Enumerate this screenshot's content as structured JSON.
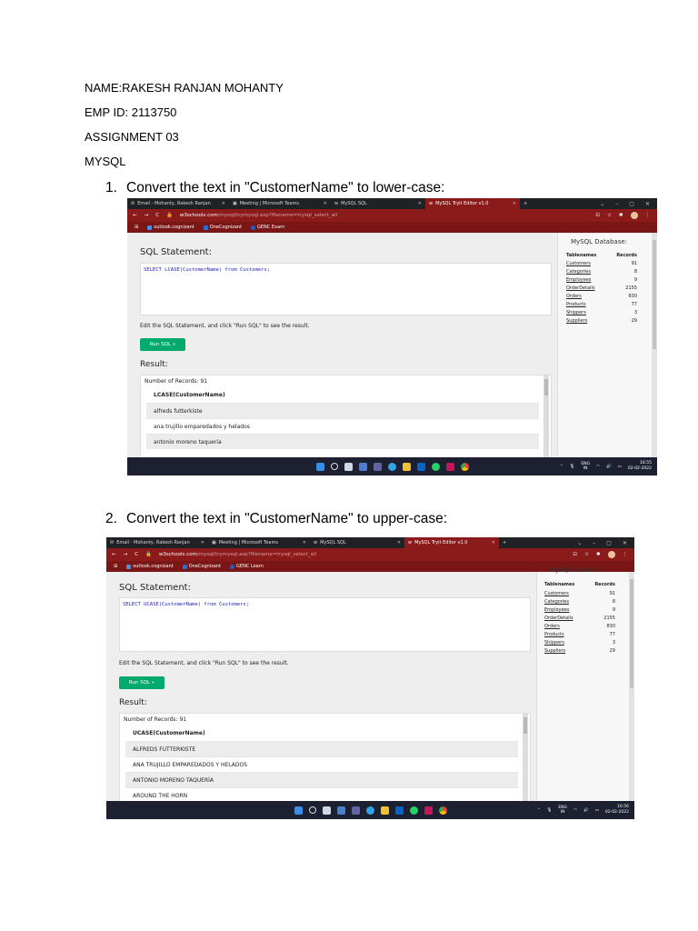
{
  "header": {
    "name_line": "NAME:RAKESH RANJAN MOHANTY",
    "emp_line": "EMP ID: 2113750",
    "assignment_line": "ASSIGNMENT 03",
    "subject_line": "MYSQL"
  },
  "questions": [
    {
      "number": "1.",
      "text": "Convert the text in \"CustomerName\" to lower-case:"
    },
    {
      "number": "2.",
      "text": "Convert the text in \"CustomerName\" to upper-case:"
    }
  ],
  "browser": {
    "tabs": [
      "Email - Mohanty, Rakesh Ranjan",
      "Meeting | Microsoft Teams",
      "MySQL SQL",
      "MySQL Tryit Editor v1.0"
    ],
    "new_tab": "+",
    "url_host": "w3schools.com",
    "url_rest": "/mysql/trymysql.asp?filename=trysql_select_all",
    "bookmarks": [
      "outlook.cognizant",
      "OneCognizant",
      "GENC Exam"
    ],
    "bookmarks_2": [
      "outlook.cognizant",
      "OneCognizant",
      "GENC Learn"
    ]
  },
  "editor": {
    "sql_title": "SQL Statement:",
    "hint": "Edit the SQL Statement, and click \"Run SQL\" to see the result.",
    "run_button": "Run SQL »",
    "result_title": "Result:",
    "db_title": "MySQL Database:",
    "db_columns": [
      "Tablenames",
      "Records"
    ],
    "db_tables": [
      {
        "name": "Customers",
        "records": "91"
      },
      {
        "name": "Categories",
        "records": "8"
      },
      {
        "name": "Employees",
        "records": "9"
      },
      {
        "name": "OrderDetails",
        "records": "2155"
      },
      {
        "name": "Orders",
        "records": "830"
      },
      {
        "name": "Products",
        "records": "77"
      },
      {
        "name": "Shippers",
        "records": "3"
      },
      {
        "name": "Suppliers",
        "records": "29"
      }
    ]
  },
  "shot1": {
    "query": "SELECT LCASE(CustomerName) from Customers;",
    "record_count": "Number of Records: 91",
    "column": "LCASE(CustomerName)",
    "rows": [
      "alfreds futterkiste",
      "ana trujillo emparedados y helados",
      "antonio moreno taquería"
    ],
    "clock_time": "16:55",
    "clock_date": "02-02-2022"
  },
  "shot2": {
    "query": "SELECT UCASE(CustomerName) from Customers;",
    "record_count": "Number of Records: 91",
    "column": "UCASE(CustomerName)",
    "rows": [
      "ALFREDS FUTTERKISTE",
      "ANA TRUJILLO EMPAREDADOS Y HELADOS",
      "ANTONIO MORENO TAQUERÍA",
      "AROUND THE HORN"
    ],
    "clock_time": "16:56",
    "clock_date": "02-02-2022"
  },
  "taskbar": {
    "lang_top": "ENG",
    "lang_bottom": "IN"
  }
}
